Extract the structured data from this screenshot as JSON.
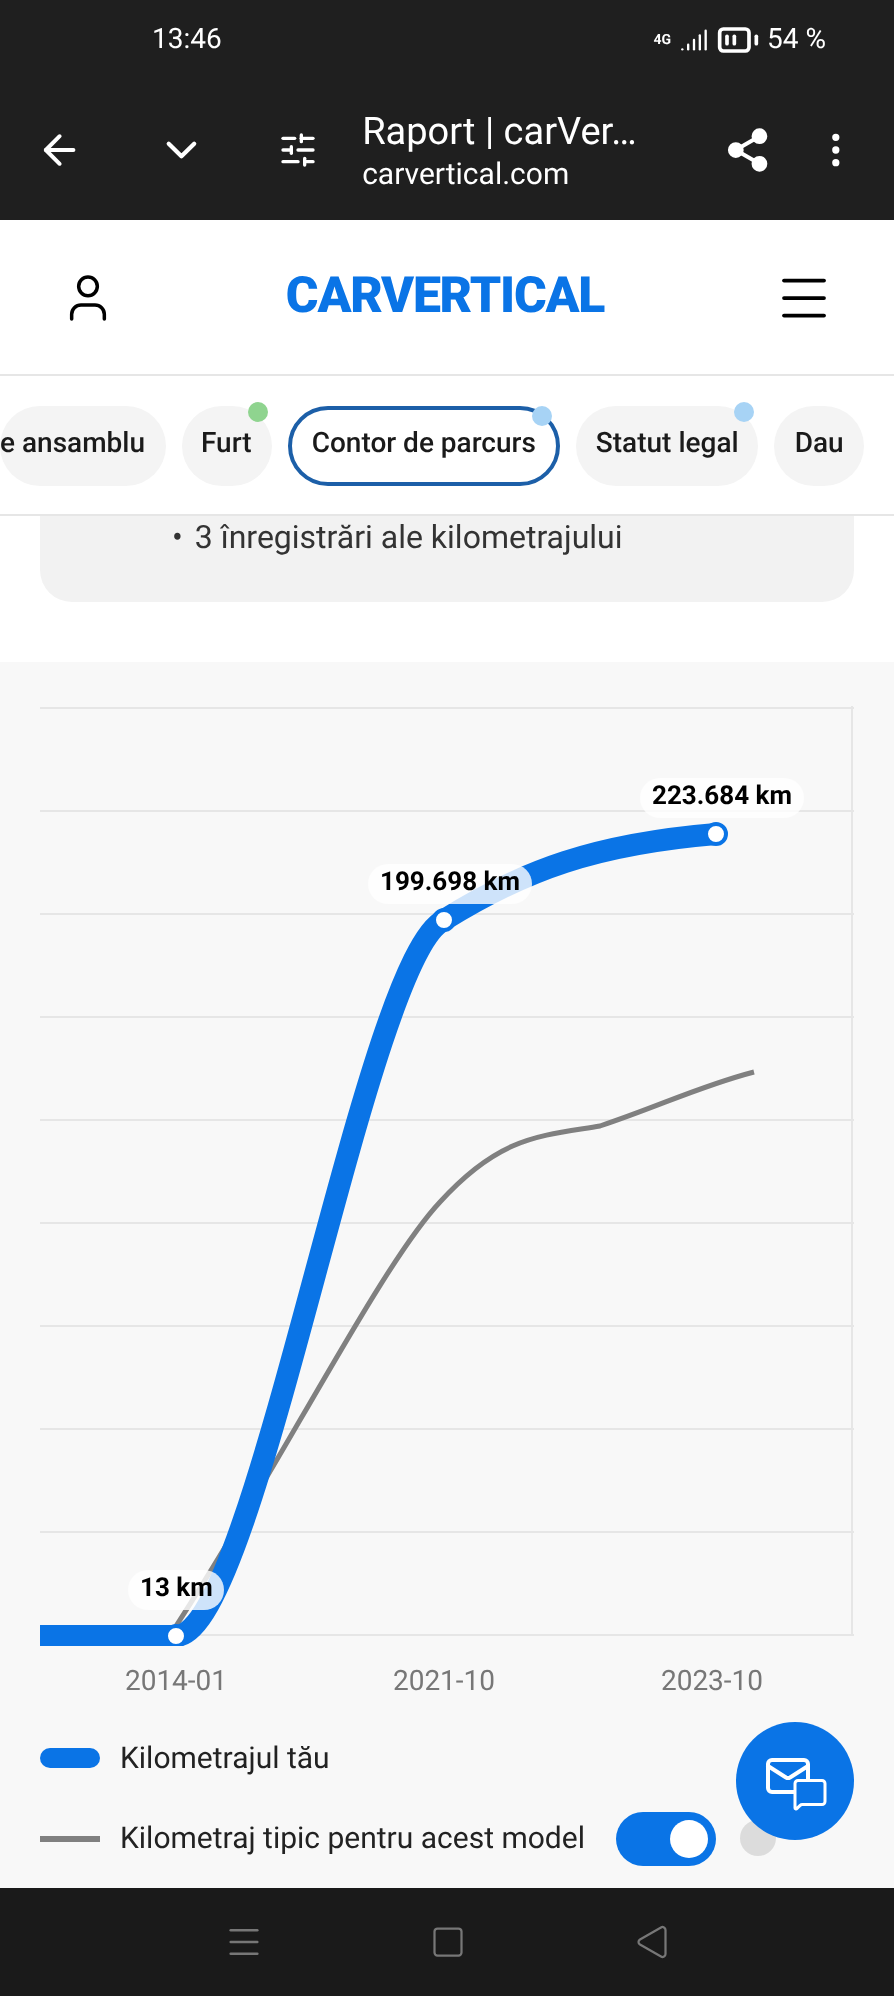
{
  "status_bar": {
    "time": "13:46",
    "network": "4G",
    "battery": "54 %"
  },
  "browser_bar": {
    "title": "Raport | carVer…",
    "url": "carvertical.com"
  },
  "header": {
    "logo": "CARVERTICAL"
  },
  "tabs": [
    {
      "label": "e ansamblu",
      "selected": false
    },
    {
      "label": "Furt",
      "selected": false,
      "color": "#8fd48f"
    },
    {
      "label": "Contor de parcurs",
      "selected": true,
      "color": "#a7d3f5"
    },
    {
      "label": "Statut legal",
      "selected": false,
      "color": "#a7d3f5"
    },
    {
      "label": "Dau",
      "selected": false
    }
  ],
  "summary": {
    "marker": "•",
    "bullet": "3 înregistrări ale kilometrajului"
  },
  "chart": {
    "point_labels": [
      "13 km",
      "199.698 km",
      "223.684 km"
    ],
    "x_labels": [
      "2014-01",
      "2021-10",
      "2023-10"
    ]
  },
  "legend": [
    {
      "label": "Kilometrajul tău",
      "kind": "thick"
    },
    {
      "label": "Kilometraj tipic pentru acest model",
      "kind": "thin",
      "toggle": {
        "on": true
      }
    }
  ]
}
